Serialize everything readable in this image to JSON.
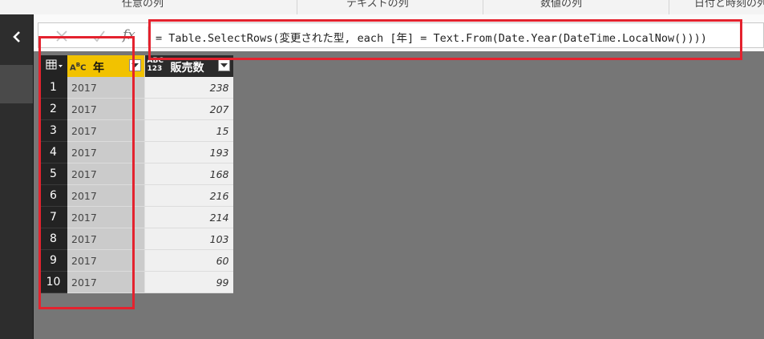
{
  "ribbon": {
    "tabs": [
      "任意の列",
      "テキストの列",
      "数値の列",
      "日付と時刻の列"
    ]
  },
  "left_pane": {
    "collapse_icon": "chevron-left-icon"
  },
  "formula_bar": {
    "cancel_icon": "close-icon",
    "commit_icon": "check-icon",
    "fx_label": "fx",
    "formula": "= Table.SelectRows(変更された型, each [年] = Text.From(Date.Year(DateTime.LocalNow())))"
  },
  "table": {
    "columns": [
      {
        "type_icon": "ABC",
        "label": "年",
        "type": "text"
      },
      {
        "type_icon": "ABC 123",
        "label": "販売数",
        "type": "any"
      }
    ],
    "rows": [
      {
        "num": "1",
        "year": "2017",
        "sales": "238"
      },
      {
        "num": "2",
        "year": "2017",
        "sales": "207"
      },
      {
        "num": "3",
        "year": "2017",
        "sales": "15"
      },
      {
        "num": "4",
        "year": "2017",
        "sales": "193"
      },
      {
        "num": "5",
        "year": "2017",
        "sales": "168"
      },
      {
        "num": "6",
        "year": "2017",
        "sales": "216"
      },
      {
        "num": "7",
        "year": "2017",
        "sales": "214"
      },
      {
        "num": "8",
        "year": "2017",
        "sales": "103"
      },
      {
        "num": "9",
        "year": "2017",
        "sales": "60"
      },
      {
        "num": "10",
        "year": "2017",
        "sales": "99"
      }
    ]
  },
  "colors": {
    "highlight": "#e4222e",
    "year_header": "#f2c200",
    "canvas": "#767676"
  }
}
